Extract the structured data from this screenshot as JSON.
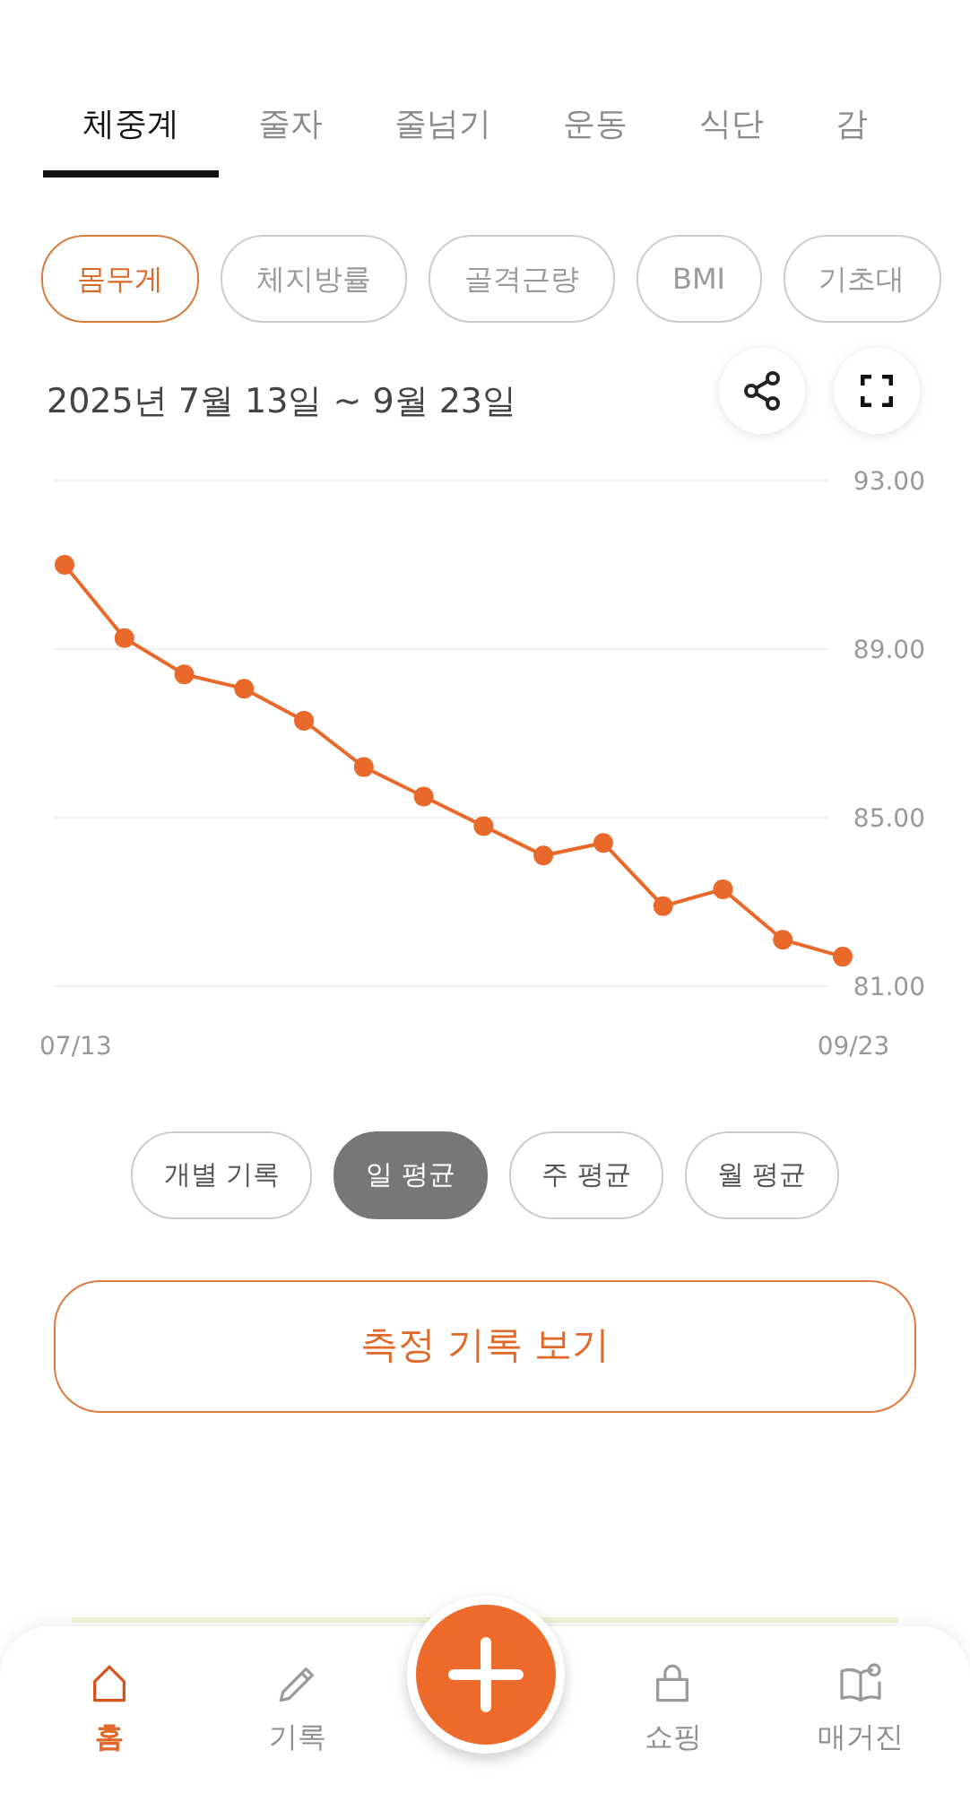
{
  "tabs": [
    {
      "label": "체중계",
      "selected": true
    },
    {
      "label": "줄자",
      "selected": false
    },
    {
      "label": "줄넘기",
      "selected": false
    },
    {
      "label": "운동",
      "selected": false
    },
    {
      "label": "식단",
      "selected": false
    },
    {
      "label": "감",
      "selected": false
    }
  ],
  "metrics": [
    {
      "label": "몸무게",
      "selected": true
    },
    {
      "label": "체지방률",
      "selected": false
    },
    {
      "label": "골격근량",
      "selected": false
    },
    {
      "label": "BMI",
      "selected": false
    },
    {
      "label": "기초대",
      "selected": false
    }
  ],
  "date_range": "2025년 7월 13일 ~ 9월 23일",
  "chart_data": {
    "type": "line",
    "categories": [
      "07/13",
      null,
      null,
      null,
      null,
      null,
      null,
      null,
      null,
      null,
      null,
      null,
      null,
      "09/23"
    ],
    "series": [
      {
        "marker": "circle",
        "color": "#e8692a",
        "values": [
          91.0,
          89.26,
          88.4,
          88.06,
          87.3,
          86.2,
          85.5,
          84.8,
          84.1,
          84.4,
          82.9,
          83.3,
          82.1,
          81.7
        ]
      }
    ],
    "ylim": [
      81,
      93
    ],
    "yticks": [
      {
        "value": 93,
        "label": "93.00"
      },
      {
        "value": 89,
        "label": "89.00"
      },
      {
        "value": 85,
        "label": "85.00"
      },
      {
        "value": 81,
        "label": "81.00"
      }
    ]
  },
  "periods": [
    {
      "label": "개별 기록",
      "selected": false
    },
    {
      "label": "일 평균",
      "selected": true
    },
    {
      "label": "주 평균",
      "selected": false
    },
    {
      "label": "월 평균",
      "selected": false
    }
  ],
  "records_button": "측정 기록 보기",
  "bottom_nav": [
    {
      "label": "홈",
      "kind": "home",
      "selected": true
    },
    {
      "label": "기록",
      "kind": "pencil",
      "selected": false
    },
    {
      "kind": "add"
    },
    {
      "label": "쇼핑",
      "kind": "bag",
      "selected": false
    },
    {
      "label": "매거진",
      "kind": "book",
      "selected": false
    }
  ]
}
